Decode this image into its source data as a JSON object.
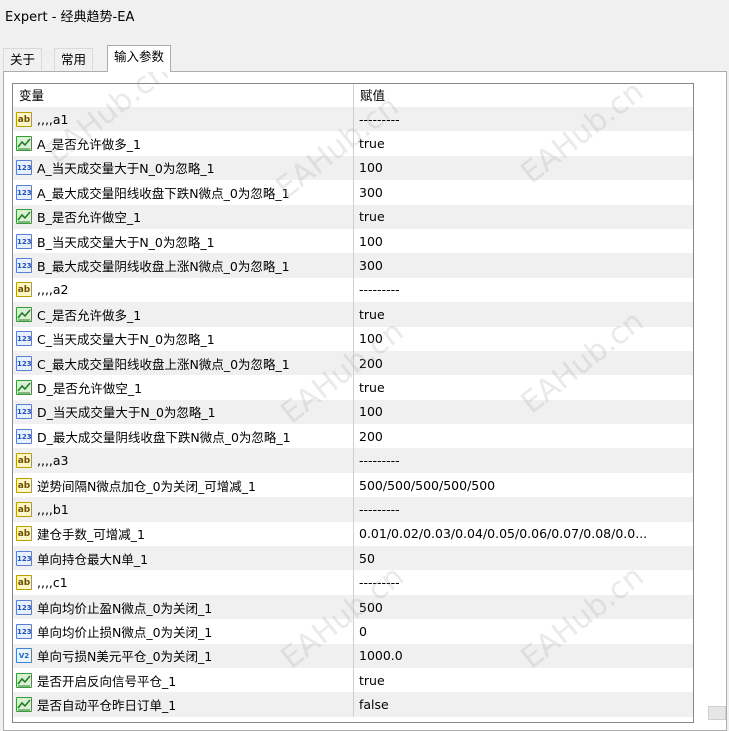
{
  "window": {
    "title": "Expert - 经典趋势-EA"
  },
  "tabs": [
    {
      "label": "关于"
    },
    {
      "label": "常用"
    },
    {
      "label": "输入参数"
    }
  ],
  "table": {
    "columns": {
      "name": "变量",
      "value": "赋值"
    },
    "rows": [
      {
        "type": "string",
        "name": ",,,,a1",
        "value": "---------"
      },
      {
        "type": "bool",
        "name": "A_是否允许做多_1",
        "value": "true"
      },
      {
        "type": "int",
        "name": "A_当天成交量大于N_0为忽略_1",
        "value": "100"
      },
      {
        "type": "int",
        "name": "A_最大成交量阳线收盘下跌N微点_0为忽略_1",
        "value": "300"
      },
      {
        "type": "bool",
        "name": "B_是否允许做空_1",
        "value": "true"
      },
      {
        "type": "int",
        "name": "B_当天成交量大于N_0为忽略_1",
        "value": "100"
      },
      {
        "type": "int",
        "name": "B_最大成交量阴线收盘上涨N微点_0为忽略_1",
        "value": "300"
      },
      {
        "type": "string",
        "name": ",,,,a2",
        "value": "---------"
      },
      {
        "type": "bool",
        "name": "C_是否允许做多_1",
        "value": "true"
      },
      {
        "type": "int",
        "name": "C_当天成交量大于N_0为忽略_1",
        "value": "100"
      },
      {
        "type": "int",
        "name": "C_最大成交量阳线收盘上涨N微点_0为忽略_1",
        "value": "200"
      },
      {
        "type": "bool",
        "name": "D_是否允许做空_1",
        "value": "true"
      },
      {
        "type": "int",
        "name": "D_当天成交量大于N_0为忽略_1",
        "value": "100"
      },
      {
        "type": "int",
        "name": "D_最大成交量阴线收盘下跌N微点_0为忽略_1",
        "value": "200"
      },
      {
        "type": "string",
        "name": ",,,,a3",
        "value": "---------"
      },
      {
        "type": "string",
        "name": "逆势间隔N微点加仓_0为关闭_可增减_1",
        "value": "500/500/500/500/500"
      },
      {
        "type": "string",
        "name": ",,,,b1",
        "value": "---------"
      },
      {
        "type": "string",
        "name": "建仓手数_可增减_1",
        "value": "0.01/0.02/0.03/0.04/0.05/0.06/0.07/0.08/0.0..."
      },
      {
        "type": "int",
        "name": "单向持仓最大N单_1",
        "value": "50"
      },
      {
        "type": "string",
        "name": ",,,,c1",
        "value": "---------"
      },
      {
        "type": "int",
        "name": "单向均价止盈N微点_0为关闭_1",
        "value": "500"
      },
      {
        "type": "int",
        "name": "单向均价止损N微点_0为关闭_1",
        "value": "0"
      },
      {
        "type": "double",
        "name": "单向亏损N美元平仓_0为关闭_1",
        "value": "1000.0"
      },
      {
        "type": "bool",
        "name": "是否开启反向信号平仓_1",
        "value": "true"
      },
      {
        "type": "bool",
        "name": "是否自动平仓昨日订单_1",
        "value": "false"
      }
    ]
  },
  "watermark": {
    "text": "EAHub.cn"
  },
  "icons": {
    "string": "ab-icon",
    "int": "int-123-icon",
    "bool": "bool-chart-icon",
    "double": "double-v2-icon"
  }
}
